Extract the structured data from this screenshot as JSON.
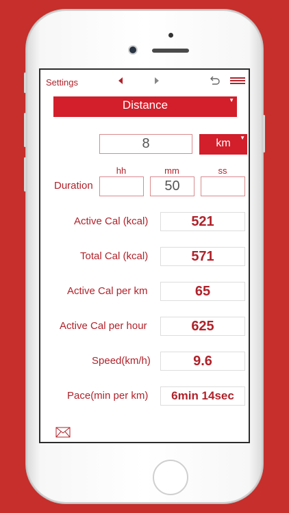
{
  "topbar": {
    "settings_label": "Settings",
    "prev_icon": "triangle-left-icon",
    "next_icon": "triangle-right-icon",
    "undo_icon": "undo-icon",
    "menu_icon": "hamburger-icon"
  },
  "mode": {
    "label": "Distance",
    "dropdown_icon": "dropdown-triangle-icon"
  },
  "distance": {
    "value": "8",
    "unit": "km"
  },
  "duration": {
    "label": "Duration",
    "headers": {
      "hh": "hh",
      "mm": "mm",
      "ss": "ss"
    },
    "values": {
      "hh": "",
      "mm": "50",
      "ss": ""
    }
  },
  "results": [
    {
      "label": "Active Cal (kcal)",
      "value": "521"
    },
    {
      "label": "Total Cal (kcal)",
      "value": "571"
    },
    {
      "label": "Active Cal per km",
      "value": "65"
    },
    {
      "label": "Active Cal per hour",
      "value": "625"
    },
    {
      "label": "Speed(km/h)",
      "value": "9.6"
    },
    {
      "label": "Pace(min per km)",
      "value": "6min 14sec"
    }
  ],
  "footer": {
    "mail_icon": "envelope-icon"
  },
  "colors": {
    "background": "#c62f2b",
    "accent": "#d21f2b",
    "text": "#b0222a"
  }
}
